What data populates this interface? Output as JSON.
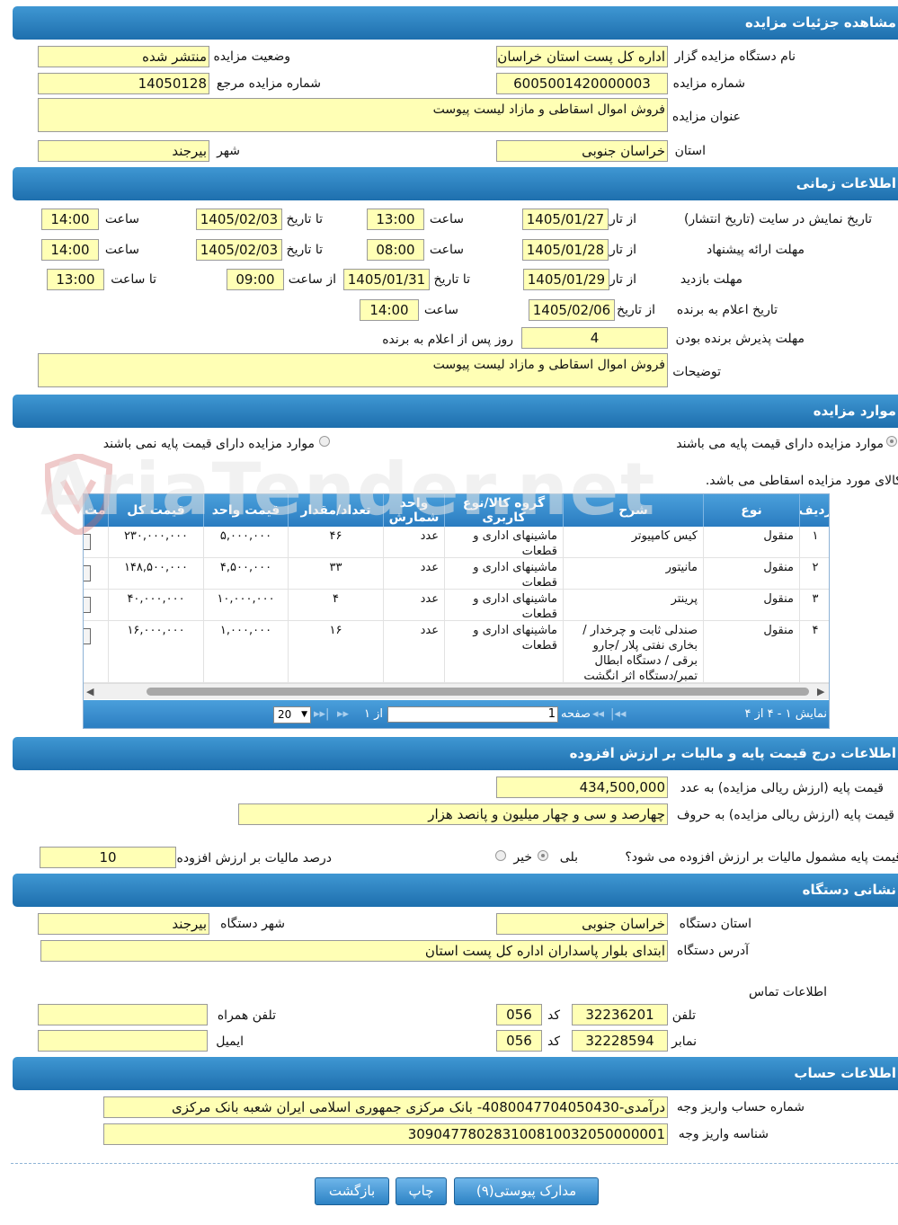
{
  "sections": {
    "details": "مشاهده جزئیات مزایده",
    "time": "اطلاعات زمانی",
    "items": "موارد مزایده",
    "price": "اطلاعات درج قیمت پایه و مالیات بر ارزش افزوده",
    "address": "نشانی دستگاه",
    "account": "اطلاعات حساب"
  },
  "details": {
    "org_label": "نام دستگاه مزایده گزار",
    "org_value": "اداره کل پست استان خراسان جنوبی",
    "status_label": "وضعیت مزایده",
    "status_value": "منتشر شده",
    "number_label": "شماره مزایده",
    "number_value": "6005001420000003",
    "ref_label": "شماره مزایده مرجع",
    "ref_value": "14050128",
    "title_label": "عنوان مزایده",
    "title_value": "فروش اموال اسقاطی و مازاد لیست پیوست",
    "province_label": "استان",
    "province_value": "خراسان جنوبی",
    "city_label": "شهر",
    "city_value": "بیرجند"
  },
  "time": {
    "display_label": "تاریخ نمایش در سایت (تاریخ انتشار)",
    "from_date_label": "از تاریخ",
    "to_date_label": "تا تاریخ",
    "time_label": "ساعت",
    "from_time_label": "از ساعت",
    "to_time_label": "تا ساعت",
    "display_from": "1405/01/27",
    "display_from_time": "13:00",
    "display_to": "1405/02/03",
    "display_to_time": "14:00",
    "offer_label": "مهلت ارائه پیشنهاد",
    "offer_from": "1405/01/28",
    "offer_from_time": "08:00",
    "offer_to": "1405/02/03",
    "offer_to_time": "14:00",
    "visit_label": "مهلت بازدید",
    "visit_from": "1405/01/29",
    "visit_to": "1405/01/31",
    "visit_from_time": "09:00",
    "visit_to_time": "13:00",
    "winner_label": "تاریخ اعلام به برنده",
    "winner_date": "1405/02/06",
    "winner_time": "14:00",
    "accept_label": "مهلت پذیرش برنده بودن",
    "accept_value": "4",
    "accept_suffix": "روز پس از اعلام به برنده",
    "desc_label": "توضیحات",
    "desc_value": "فروش اموال اسقاطی و مازاد لیست پیوست"
  },
  "items": {
    "radio_with_price": "موارد مزایده دارای قیمت پایه می باشند",
    "radio_without_price": "موارد مزایده دارای قیمت پایه نمی باشند",
    "note": "کالای مورد مزایده اسقاطی می باشد.",
    "columns": [
      "ردیف",
      "نوع",
      "شرح",
      "گروه کالا/نوع کاربری",
      "واحد شمارش",
      "تعداد/مقدار",
      "قیمت واحد",
      "قیمت کل",
      "مت"
    ],
    "rows": [
      {
        "idx": "۱",
        "type": "منقول",
        "desc": "کیس کامپیوتر",
        "group": "ماشینهای اداری و قطعات",
        "unit": "عدد",
        "qty": "۴۶",
        "unit_price": "۵,۰۰۰,۰۰۰",
        "total": "۲۳۰,۰۰۰,۰۰۰"
      },
      {
        "idx": "۲",
        "type": "منقول",
        "desc": "مانیتور",
        "group": "ماشینهای اداری و قطعات",
        "unit": "عدد",
        "qty": "۳۳",
        "unit_price": "۴,۵۰۰,۰۰۰",
        "total": "۱۴۸,۵۰۰,۰۰۰"
      },
      {
        "idx": "۳",
        "type": "منقول",
        "desc": "پرینتر",
        "group": "ماشینهای اداری و قطعات",
        "unit": "عدد",
        "qty": "۴",
        "unit_price": "۱۰,۰۰۰,۰۰۰",
        "total": "۴۰,۰۰۰,۰۰۰"
      },
      {
        "idx": "۴",
        "type": "منقول",
        "desc": "صندلی ثابت و چرخدار / بخاری نفتی پلار /جارو برقی / دستگاه ابطال تمبر/دستگاه اثر انگشت",
        "group": "ماشینهای اداری و قطعات",
        "unit": "عدد",
        "qty": "۱۶",
        "unit_price": "۱,۰۰۰,۰۰۰",
        "total": "۱۶,۰۰۰,۰۰۰"
      }
    ],
    "pager": {
      "summary": "نمایش ۱ - ۴ از ۴",
      "page_label": "صفحه",
      "page_value": "1",
      "of_label": "از ۱",
      "page_size": "20"
    }
  },
  "price": {
    "base_num_label": "قیمت پایه (ارزش ریالی مزایده) به عدد",
    "base_num_value": "434,500,000",
    "base_text_label": "قیمت پایه (ارزش ریالی مزایده) به حروف",
    "base_text_value": "چهارصد و سی و چهار میلیون و پانصد هزار",
    "vat_q_label": "قیمت پایه مشمول مالیات بر ارزش افزوده می شود؟",
    "yes_label": "بلی",
    "no_label": "خیر",
    "vat_pct_label": "درصد مالیات بر ارزش افزوده",
    "vat_pct_value": "10"
  },
  "address": {
    "province_label": "استان دستگاه",
    "province_value": "خراسان جنوبی",
    "city_label": "شهر دستگاه",
    "city_value": "بیرجند",
    "addr_label": "آدرس دستگاه",
    "addr_value": "ابتدای بلوار پاسداران اداره کل پست استان",
    "contact_label": "اطلاعات تماس",
    "phone_label": "تلفن",
    "phone_value": "32236201",
    "code_label": "کد",
    "phone_code": "056",
    "fax_label": "نمابر",
    "fax_value": "32228594",
    "fax_code": "056",
    "mobile_label": "تلفن همراه",
    "mobile_value": "",
    "email_label": "ایمیل",
    "email_value": ""
  },
  "account": {
    "acc_label": "شماره حساب واریز وجه",
    "acc_value": "درآمدی-4080047704050430- بانک مرکزی جمهوری اسلامی ایران شعبه بانک مرکزی",
    "id_label": "شناسه واریز وجه",
    "id_value": "309047780283100810032050000001"
  },
  "buttons": {
    "attachments": "مدارک پیوستی(۹)",
    "print": "چاپ",
    "back": "بازگشت"
  },
  "watermark": "AriaTender.net",
  "colors": {
    "header": "#2a7cc0",
    "field": "#ffffb5",
    "button": "#2c82c4"
  }
}
